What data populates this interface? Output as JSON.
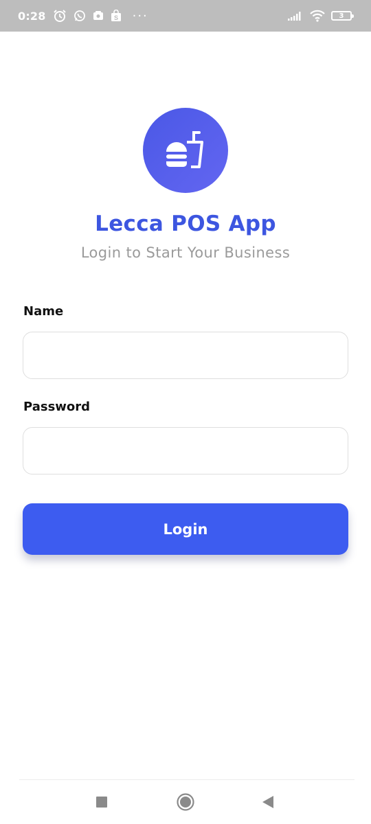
{
  "status_bar": {
    "time": "0:28",
    "left_icons": [
      "alarm-icon",
      "whatsapp-icon",
      "image-icon",
      "shopping-bag-icon"
    ],
    "more_indicator": "···",
    "battery_level": "3"
  },
  "login": {
    "app_title": "Lecca POS App",
    "subtitle": "Login to Start Your Business",
    "name_label": "Name",
    "name_value": "",
    "password_label": "Password",
    "password_value": "",
    "login_button": "Login"
  },
  "colors": {
    "accent": "#3d5cf0",
    "title": "#3d56e0",
    "subtitle": "#9a9a9a",
    "status_bar": "#bdbdbd"
  },
  "nav_bar": {
    "icons": [
      "recent-apps-icon",
      "home-icon",
      "back-icon"
    ]
  }
}
